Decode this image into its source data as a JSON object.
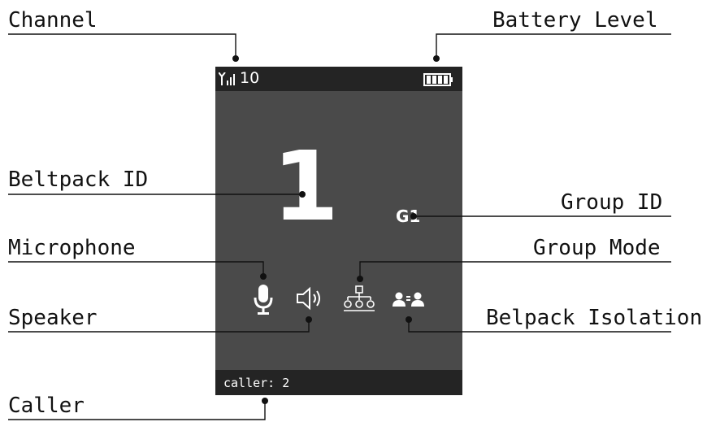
{
  "labels": {
    "channel": "Channel",
    "battery": "Battery Level",
    "beltpack_id": "Beltpack ID",
    "group_id": "Group ID",
    "microphone": "Microphone",
    "group_mode": "Group Mode",
    "speaker": "Speaker",
    "isolation": "Belpack Isolation",
    "caller": "Caller"
  },
  "screen": {
    "channel_value": "10",
    "beltpack_id": "1",
    "group_id": "G1",
    "caller_text": "caller: 2"
  },
  "colors": {
    "screen_bg": "#4a4a4a",
    "bar_bg": "#242424",
    "text": "#ffffff",
    "line": "#111111"
  },
  "icons": [
    "signal-icon",
    "battery-icon",
    "microphone-icon",
    "speaker-icon",
    "group-mode-icon",
    "isolation-icon"
  ]
}
